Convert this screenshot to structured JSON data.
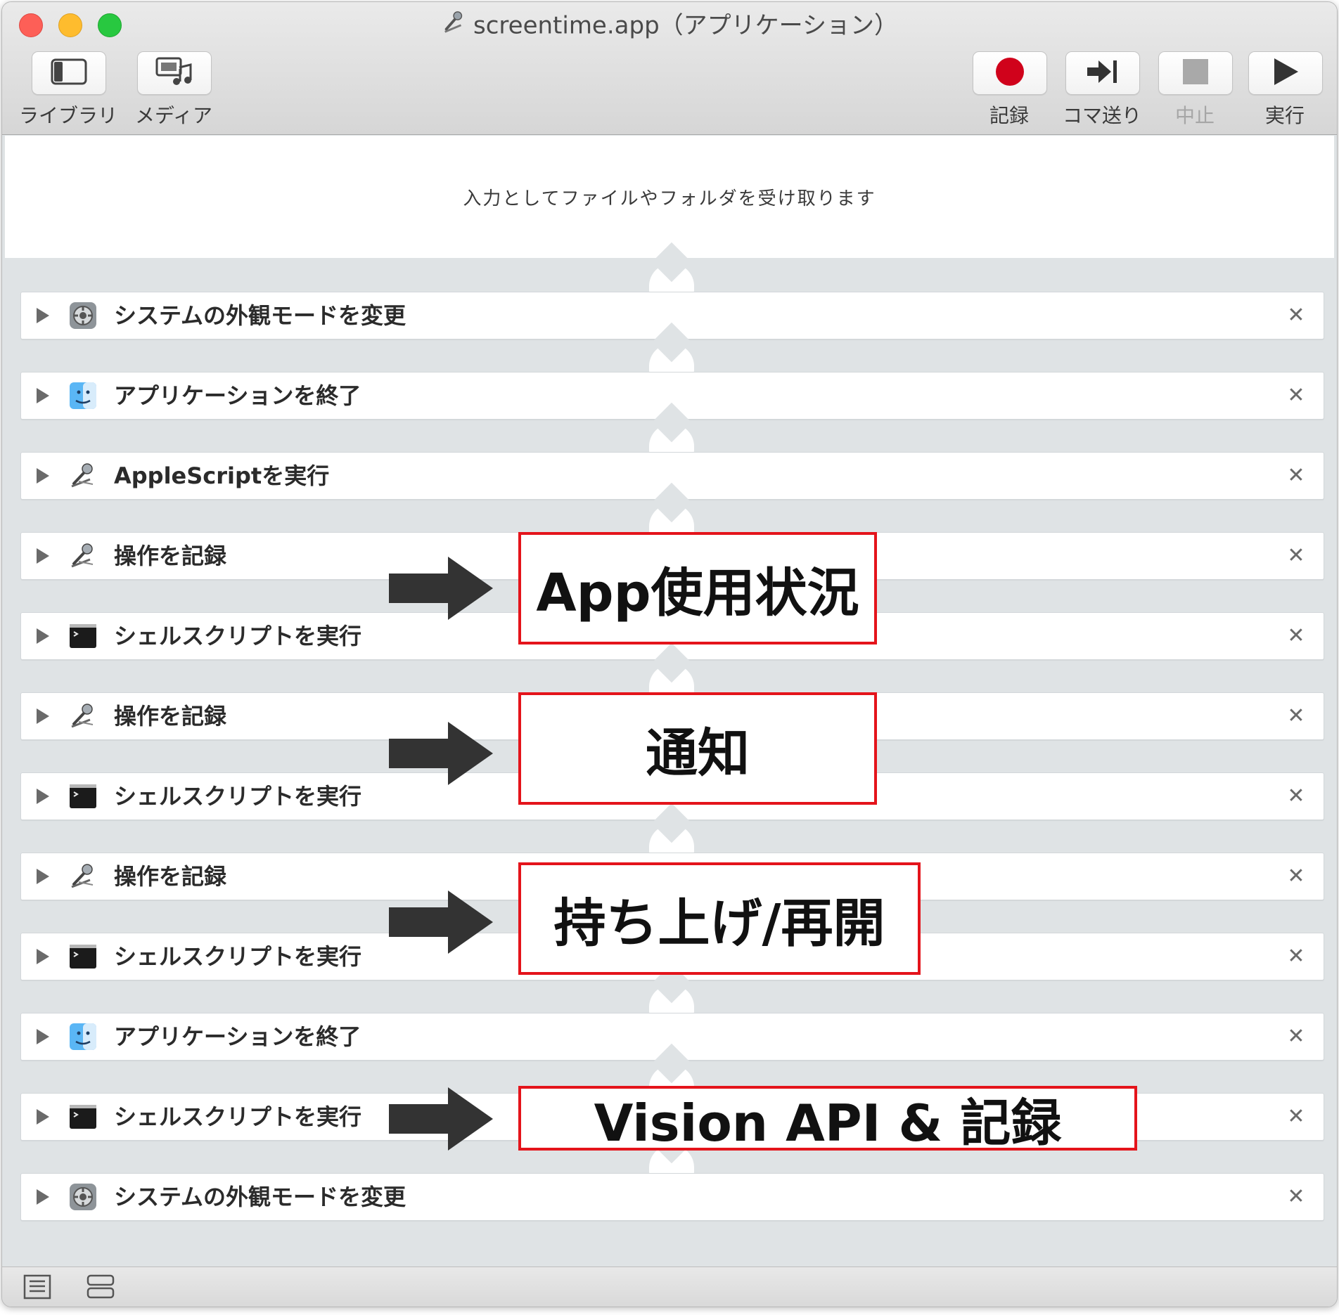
{
  "window": {
    "title": "screentime.app（アプリケーション）"
  },
  "toolbar": {
    "left": [
      {
        "label": "ライブラリ",
        "icon": "sidebar-icon"
      },
      {
        "label": "メディア",
        "icon": "media-icon"
      }
    ],
    "right": [
      {
        "label": "記録",
        "icon": "record-icon",
        "color": "#d0021b"
      },
      {
        "label": "コマ送り",
        "icon": "step-icon"
      },
      {
        "label": "中止",
        "icon": "stop-icon",
        "disabled": true
      },
      {
        "label": "実行",
        "icon": "play-icon"
      }
    ]
  },
  "input_area": {
    "text": "入力としてファイルやフォルダを受け取ります"
  },
  "actions": [
    {
      "label": "システムの外観モードを変更",
      "icon": "system-preferences-icon"
    },
    {
      "label": "アプリケーションを終了",
      "icon": "finder-icon"
    },
    {
      "label": "AppleScriptを実行",
      "icon": "automator-robot-icon"
    },
    {
      "label": "操作を記録",
      "icon": "automator-robot-icon"
    },
    {
      "label": "シェルスクリプトを実行",
      "icon": "terminal-icon"
    },
    {
      "label": "操作を記録",
      "icon": "automator-robot-icon"
    },
    {
      "label": "シェルスクリプトを実行",
      "icon": "terminal-icon"
    },
    {
      "label": "操作を記録",
      "icon": "automator-robot-icon"
    },
    {
      "label": "シェルスクリプトを実行",
      "icon": "terminal-icon"
    },
    {
      "label": "アプリケーションを終了",
      "icon": "finder-icon"
    },
    {
      "label": "シェルスクリプトを実行",
      "icon": "terminal-icon"
    },
    {
      "label": "システムの外観モードを変更",
      "icon": "system-preferences-icon"
    }
  ],
  "callouts": [
    {
      "text": "App使用状況"
    },
    {
      "text": "通知"
    },
    {
      "text": "持ち上げ/再開"
    },
    {
      "text": "Vision API & 記録"
    }
  ],
  "colors": {
    "callout_border": "#e4141b",
    "arrow": "#333333"
  }
}
